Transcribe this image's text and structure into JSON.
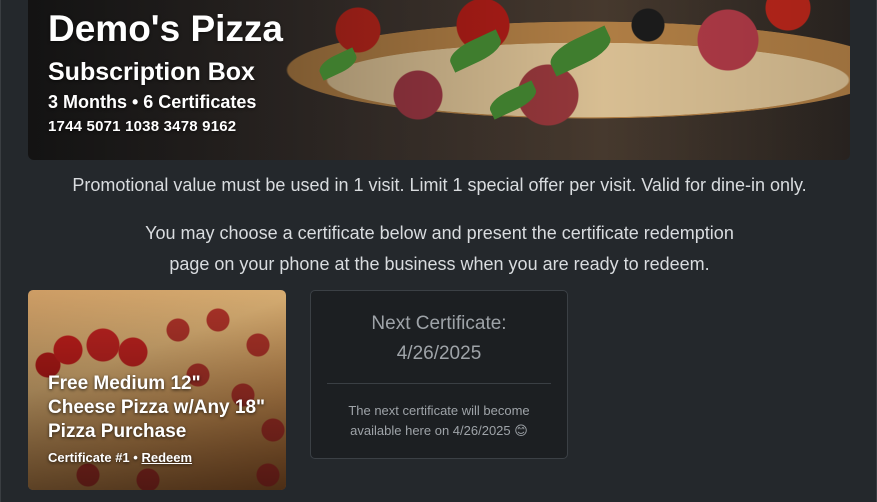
{
  "hero": {
    "title": "Demo's Pizza",
    "subtitle": "Subscription Box",
    "meta": "3 Months • 6 Certificates",
    "code": "1744 5071 1038 3478 9162"
  },
  "promo_text": "Promotional value must be used in 1 visit. Limit 1 special offer per visit. Valid for dine-in only.",
  "instructions": {
    "line1": "You may choose a certificate below and present the certificate redemption",
    "line2": "page on your phone at the business when you are ready to redeem."
  },
  "certificate": {
    "title": "Free Medium 12\" Cheese Pizza w/Any 18\" Pizza Purchase",
    "number": "Certificate #1",
    "separator": "•",
    "redeem_label": "Redeem"
  },
  "next_certificate": {
    "label": "Next Certificate:",
    "date": "4/26/2025",
    "note": "The next certificate will become available here on 4/26/2025 😊"
  },
  "colors": {
    "background": "#24282c",
    "card_background": "#1c1f22",
    "text": "#d9dcdf",
    "muted_text": "#9ea3a8"
  }
}
